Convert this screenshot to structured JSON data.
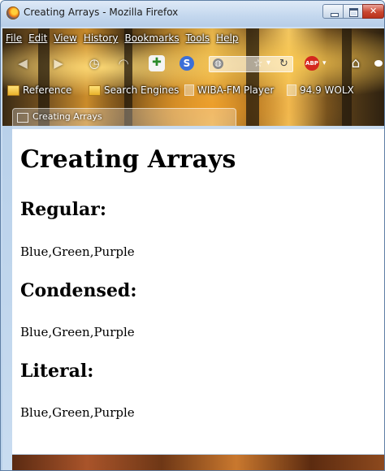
{
  "window": {
    "title": "Creating Arrays - Mozilla Firefox"
  },
  "menubar": {
    "items": [
      {
        "label": "File"
      },
      {
        "label": "Edit"
      },
      {
        "label": "View"
      },
      {
        "label": "History"
      },
      {
        "label": "Bookmarks"
      },
      {
        "label": "Tools"
      },
      {
        "label": "Help"
      }
    ]
  },
  "navbar": {
    "icons": [
      "back-icon",
      "forward-icon",
      "history-icon",
      "rss-icon",
      "addon-icon",
      "s-icon",
      "globe-icon",
      "star-icon",
      "reload-icon",
      "adblock-icon",
      "home-icon"
    ],
    "abp_label": "ABP"
  },
  "bookmarks": [
    {
      "label": "Reference",
      "icon": "folder-icon"
    },
    {
      "label": "Search Engines",
      "icon": "folder-icon"
    },
    {
      "label": "WIBA-FM Player",
      "icon": "page-icon"
    },
    {
      "label": "94.9 WOLX",
      "icon": "page-icon"
    }
  ],
  "tabs": [
    {
      "label": "Creating Arrays"
    }
  ],
  "page": {
    "title": "Creating Arrays",
    "sections": [
      {
        "heading": "Regular:",
        "text": "Blue,Green,Purple"
      },
      {
        "heading": "Condensed:",
        "text": "Blue,Green,Purple"
      },
      {
        "heading": "Literal:",
        "text": "Blue,Green,Purple"
      }
    ]
  },
  "colors": {
    "titlebar": "#c3d7ee",
    "close_button": "#c9462f",
    "persona_gold": "#e4b24a"
  }
}
